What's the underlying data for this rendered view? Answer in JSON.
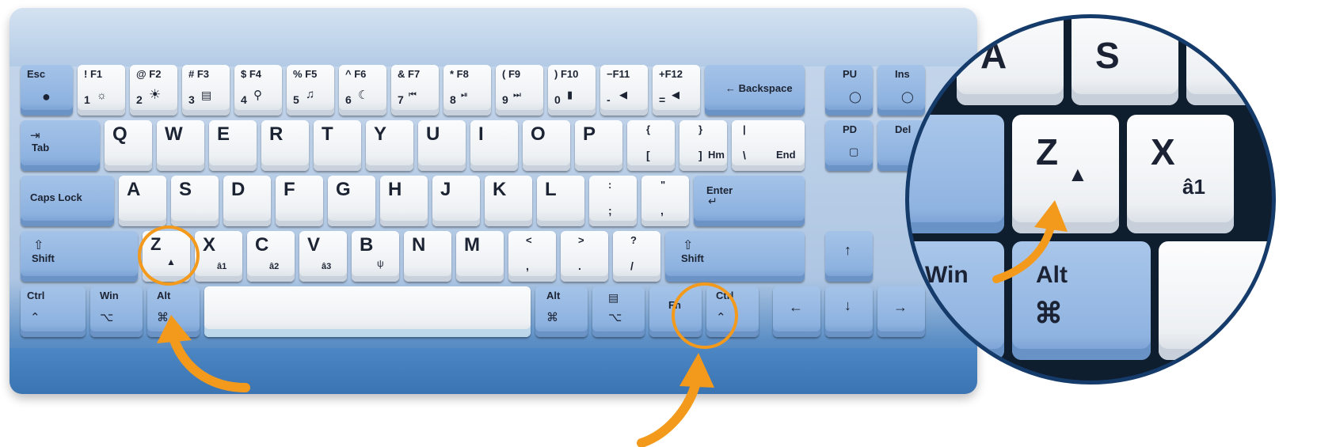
{
  "keys": {
    "esc": {
      "label": "Esc"
    },
    "n1": {
      "top": "! F1",
      "bot": "1"
    },
    "n2": {
      "top": "@ F2",
      "bot": "2"
    },
    "n3": {
      "top": "# F3",
      "bot": "3"
    },
    "n4": {
      "top": "$ F4",
      "bot": "4"
    },
    "n5": {
      "top": "% F5",
      "bot": "5"
    },
    "n6": {
      "top": "^ F6",
      "bot": "6"
    },
    "n7": {
      "top": "& F7",
      "bot": "7"
    },
    "n8": {
      "top": "* F8",
      "bot": "8"
    },
    "n9": {
      "top": "( F9",
      "bot": "9"
    },
    "n0": {
      "top": ") F10",
      "bot": "0"
    },
    "minus": {
      "top": "−F11",
      "bot": "-"
    },
    "equal": {
      "top": "+F12",
      "bot": "="
    },
    "backspace": {
      "label": "← Backspace"
    },
    "pu": {
      "label": "PU"
    },
    "ins": {
      "label": "Ins"
    },
    "tab": {
      "label": "Tab"
    },
    "q": "Q",
    "w": "W",
    "e": "E",
    "r": "R",
    "t": "T",
    "y": "Y",
    "u": "U",
    "i": "I",
    "o": "O",
    "p": "P",
    "lbrace": {
      "top": "{",
      "bot": "["
    },
    "rbrace": {
      "top": "}",
      "bot": "]",
      "sub": "Hm"
    },
    "pipe": {
      "top": "|",
      "bot": "\\",
      "sub": "End"
    },
    "pd": {
      "label": "PD"
    },
    "del": {
      "label": "Del"
    },
    "caps": {
      "label": "Caps Lock"
    },
    "a": "A",
    "s": "S",
    "d": "D",
    "f": "F",
    "g": "G",
    "h": "H",
    "j": "J",
    "k": "K",
    "l": "L",
    "semi": {
      "top": ":",
      "bot": ";"
    },
    "quote": {
      "top": "\"",
      "bot": ","
    },
    "enter": {
      "label": "Enter"
    },
    "lshift": {
      "label": "Shift"
    },
    "z": "Z",
    "x": {
      "main": "X",
      "sub": "â1"
    },
    "c": {
      "main": "C",
      "sub": "â2"
    },
    "v": {
      "main": "V",
      "sub": "â3"
    },
    "b": "B",
    "n": "N",
    "m": "M",
    "comma": {
      "top": "<",
      "bot": ","
    },
    "period": {
      "top": ">",
      "bot": "."
    },
    "slash": {
      "top": "?",
      "bot": "/"
    },
    "rshift": {
      "label": "Shift"
    },
    "lctrl": {
      "label": "Ctrl"
    },
    "lwin": {
      "label": "Win"
    },
    "lalt": {
      "label": "Alt"
    },
    "ralt": {
      "label": "Alt"
    },
    "fn": {
      "label": "Fn"
    },
    "rctrl": {
      "label": "Ctrl"
    }
  },
  "zoom": {
    "a": "A",
    "s": "S",
    "z": "Z",
    "x": "X",
    "x_sub": "â1",
    "win": "Win",
    "alt": "Alt"
  },
  "colors": {
    "highlight": "#f39a1c",
    "blue_key": "#8db2e0",
    "white_key": "#f3f5f7",
    "zoom_border": "#153b6b"
  }
}
